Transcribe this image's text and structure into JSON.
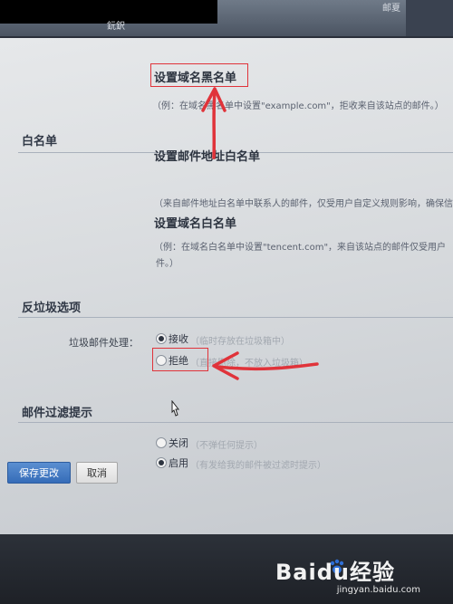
{
  "topbar": {
    "text_left": "鈨鈬",
    "text_right": "邮夏"
  },
  "blacklist": {
    "domain_title": "设置域名黑名单",
    "domain_desc": "（例：在域名黑名单中设置\"example.com\"，拒收来自该站点的邮件。）"
  },
  "whitelist": {
    "section_title": "白名单",
    "address_title": "设置邮件地址白名单",
    "address_desc": "（来自邮件地址白名单中联系人的邮件，仅受用户自定义规则影响，确保信",
    "domain_title": "设置域名白名单",
    "domain_desc_line1": "（例：在域名白名单中设置\"tencent.com\"，来自该站点的邮件仅受用户",
    "domain_desc_line2": "件。）"
  },
  "antispam": {
    "section_title": "反垃圾选项",
    "field_label": "垃圾邮件处理：",
    "options": [
      {
        "label": "接收",
        "hint": "（临时存放在垃圾箱中）",
        "checked": true
      },
      {
        "label": "拒绝",
        "hint": "（直接删除，不放入垃圾箱）",
        "checked": false
      }
    ]
  },
  "filter_notice": {
    "section_title": "邮件过滤提示",
    "options": [
      {
        "label": "关闭",
        "hint": "（不弹任何提示）",
        "checked": false
      },
      {
        "label": "启用",
        "hint": "（有发给我的邮件被过滤时提示）",
        "checked": true
      }
    ]
  },
  "buttons": {
    "save": "保存更改",
    "cancel": "取消"
  },
  "watermark": {
    "brand": "Baidu经验",
    "url": "jingyan.baidu.com"
  },
  "colors": {
    "annotation_red": "#e0333a",
    "primary_button": "#356cb8"
  }
}
